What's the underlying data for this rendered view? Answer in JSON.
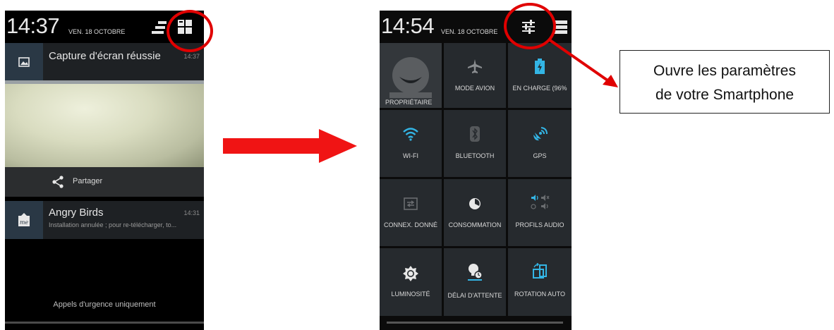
{
  "left_phone": {
    "clock": "14:37",
    "date": "VEN. 18 OCTOBRE",
    "notifications": [
      {
        "title": "Capture d'écran réussie",
        "time": "14:37",
        "icon": "image-icon"
      },
      {
        "title": "Angry Birds",
        "time": "14:31",
        "subtitle": "Installation annulée ; pour re-télécharger, to...",
        "icon": "download-me-icon"
      }
    ],
    "share_label": "Partager",
    "emergency_text": "Appels d'urgence uniquement"
  },
  "right_phone": {
    "clock": "14:54",
    "date": "VEN. 18 OCTOBRE",
    "tiles": [
      {
        "label": "PROPRIÉTAIRE",
        "icon": "owner-avatar-icon"
      },
      {
        "label": "MODE AVION",
        "icon": "airplane-icon"
      },
      {
        "label": "EN CHARGE (96%",
        "icon": "battery-charging-icon"
      },
      {
        "label": "WI-FI",
        "icon": "wifi-icon"
      },
      {
        "label": "BLUETOOTH",
        "icon": "bluetooth-icon"
      },
      {
        "label": "GPS",
        "icon": "gps-icon"
      },
      {
        "label": "CONNEX. DONNÉ",
        "icon": "data-connection-icon"
      },
      {
        "label": "CONSOMMATION",
        "icon": "consumption-icon"
      },
      {
        "label": "PROFILS AUDIO",
        "icon": "audio-profiles-icon"
      },
      {
        "label": "LUMINOSITÉ",
        "icon": "brightness-icon"
      },
      {
        "label": "DÉLAI D'ATTENTE",
        "icon": "timeout-icon"
      },
      {
        "label": "ROTATION AUTO",
        "icon": "auto-rotate-icon"
      }
    ]
  },
  "callout": {
    "line1": "Ouvre les paramètres",
    "line2": "de votre Smartphone"
  },
  "colors": {
    "annotation_red": "#e00000",
    "accent_blue": "#33b5e5"
  }
}
